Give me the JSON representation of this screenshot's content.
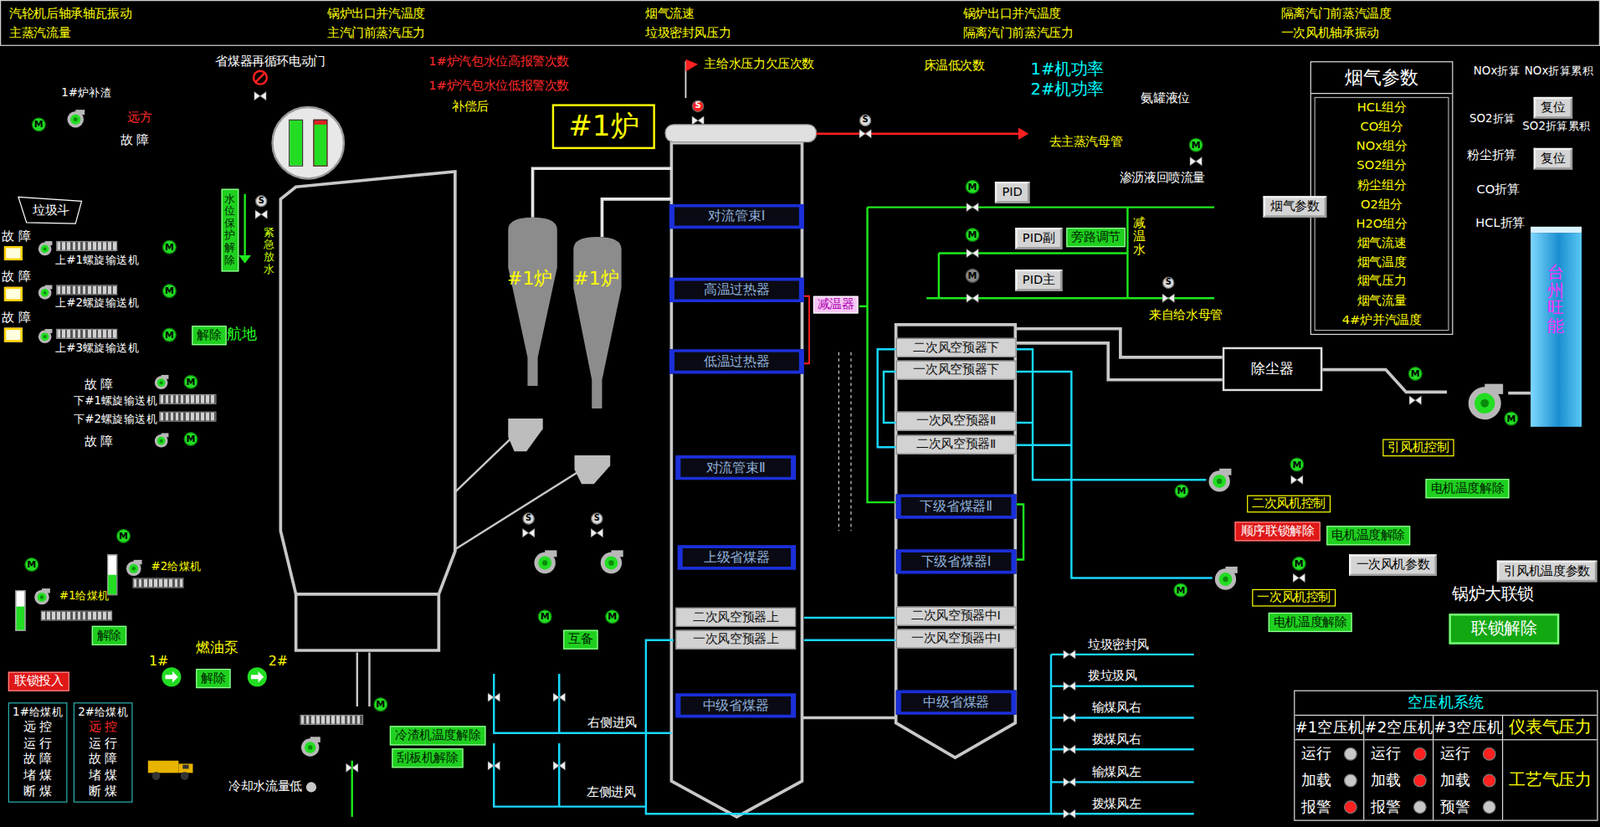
{
  "topBar": [
    "汽轮机后轴承轴瓦振动",
    "锅炉出口并汽温度",
    "烟气流速",
    "锅炉出口并汽温度",
    "隔离汽门前蒸汽温度",
    "主蒸汽流量",
    "主汽门前蒸汽压力",
    "垃圾密封风压力",
    "隔离汽门前蒸汽压力",
    "一次风机轴承振动"
  ],
  "labels": [
    {
      "text": "省煤器再循环电动门",
      "kind": "white"
    },
    {
      "text": "1#炉补渣",
      "kind": "white"
    },
    {
      "text": "远方",
      "kind": "red"
    },
    {
      "text": "故 障",
      "kind": "white"
    },
    {
      "text": "垃圾斗",
      "kind": "white"
    },
    {
      "text": "故 障",
      "kind": "white"
    },
    {
      "text": "上#1螺旋输送机",
      "kind": "white"
    },
    {
      "text": "故 障",
      "kind": "white"
    },
    {
      "text": "上#2螺旋输送机",
      "kind": "white"
    },
    {
      "text": "故 障",
      "kind": "white"
    },
    {
      "text": "上#3螺旋输送机",
      "kind": "white"
    },
    {
      "text": "解除",
      "kind": "btn"
    },
    {
      "text": "航地",
      "kind": "green"
    },
    {
      "text": "故 障",
      "kind": "white"
    },
    {
      "text": "下#1螺旋输送机",
      "kind": "white"
    },
    {
      "text": "下#2螺旋输送机",
      "kind": "white"
    },
    {
      "text": "故 障",
      "kind": "white"
    },
    {
      "text": "#2给煤机",
      "kind": "yellow"
    },
    {
      "text": "#1给煤机",
      "kind": "yellow"
    },
    {
      "text": "解除",
      "kind": "btn"
    },
    {
      "text": "联锁投入",
      "kind": "btnRed"
    },
    {
      "text": "燃油泵",
      "kind": "yellow"
    },
    {
      "text": "1#",
      "kind": "yellow"
    },
    {
      "text": "2#",
      "kind": "yellow"
    },
    {
      "text": "解除",
      "kind": "btn"
    },
    {
      "text": "冷渣机温度解除",
      "kind": "btn"
    },
    {
      "text": "刮板机解除",
      "kind": "btn"
    },
    {
      "text": "冷却水流量低",
      "kind": "white"
    },
    {
      "text": "1#炉汽包水位高报警次数",
      "kind": "red"
    },
    {
      "text": "1#炉汽包水位低报警次数",
      "kind": "red"
    },
    {
      "text": "补偿后",
      "kind": "yellow"
    },
    {
      "text": "主给水压力欠压次数",
      "kind": "yellow"
    },
    {
      "text": "床温低次数",
      "kind": "yellow"
    },
    {
      "text": "1#机功率",
      "kind": "cyan"
    },
    {
      "text": "2#机功率",
      "kind": "cyan"
    },
    {
      "text": "氨罐液位",
      "kind": "white"
    },
    {
      "text": "去主蒸汽母管",
      "kind": "yellow"
    },
    {
      "text": "渗沥液回喷流量",
      "kind": "white"
    },
    {
      "text": "PID",
      "kind": "btnGray"
    },
    {
      "text": "PID副",
      "kind": "btnGray"
    },
    {
      "text": "旁路调节",
      "kind": "btn"
    },
    {
      "text": "PID主",
      "kind": "btnGray"
    },
    {
      "text": "减温器",
      "kind": "pink"
    },
    {
      "text": "来自给水母管",
      "kind": "yellow"
    },
    {
      "text": "互备",
      "kind": "btn"
    },
    {
      "text": "右侧进风",
      "kind": "white"
    },
    {
      "text": "左侧进风",
      "kind": "white"
    },
    {
      "text": "垃圾密封风",
      "kind": "white"
    },
    {
      "text": "拨垃圾风",
      "kind": "white"
    },
    {
      "text": "输煤风右",
      "kind": "white"
    },
    {
      "text": "拨煤风右",
      "kind": "white"
    },
    {
      "text": "输煤风左",
      "kind": "white"
    },
    {
      "text": "拨煤风左",
      "kind": "white"
    },
    {
      "text": "烟气参数",
      "kind": "btnGray"
    },
    {
      "text": "NOx折算",
      "kind": "white"
    },
    {
      "text": "NOx折算累积",
      "kind": "white"
    },
    {
      "text": "复位",
      "kind": "btnGray"
    },
    {
      "text": "SO2折算",
      "kind": "white"
    },
    {
      "text": "SO2折算累积",
      "kind": "white"
    },
    {
      "text": "粉尘折算",
      "kind": "white"
    },
    {
      "text": "复位",
      "kind": "btnGray"
    },
    {
      "text": "CO折算",
      "kind": "white"
    },
    {
      "text": "HCL折算",
      "kind": "white"
    },
    {
      "text": "引风机控制",
      "kind": "frame"
    },
    {
      "text": "电机温度解除",
      "kind": "btn"
    },
    {
      "text": "二次风机控制",
      "kind": "frame"
    },
    {
      "text": "顺序联锁解除",
      "kind": "btnRed"
    },
    {
      "text": "电机温度解除",
      "kind": "btn"
    },
    {
      "text": "一次风机参数",
      "kind": "btnGray"
    },
    {
      "text": "引风机温度参数",
      "kind": "btnGray"
    },
    {
      "text": "一次风机控制",
      "kind": "frame"
    },
    {
      "text": "电机温度解除",
      "kind": "btn"
    },
    {
      "text": "锅炉大联锁",
      "kind": "white"
    },
    {
      "text": "联锁解除",
      "kind": "btnBig"
    },
    {
      "text": "#1炉",
      "kind": "title"
    },
    {
      "text": "#1炉",
      "kind": "yellow"
    },
    {
      "text": "#1炉",
      "kind": "yellow"
    }
  ],
  "verticals": [
    {
      "text": "水位保护解除",
      "kind": "vbtn"
    },
    {
      "text": "紧急放水",
      "kind": "vlime"
    },
    {
      "text": "减温水",
      "kind": "vyellow"
    },
    {
      "text": "台州旺能",
      "kind": "vchimney"
    }
  ],
  "exchangers": [
    {
      "text": "对流管束Ⅰ",
      "kind": "coil"
    },
    {
      "text": "高温过热器",
      "kind": "coil"
    },
    {
      "text": "低温过热器",
      "kind": "coil"
    },
    {
      "text": "对流管束Ⅱ",
      "kind": "coil"
    },
    {
      "text": "上级省煤器",
      "kind": "coil"
    },
    {
      "text": "二次风空预器上",
      "kind": "air"
    },
    {
      "text": "一次风空预器上",
      "kind": "air"
    },
    {
      "text": "中级省煤器",
      "kind": "coil"
    },
    {
      "text": "二次风空预器下",
      "kind": "air"
    },
    {
      "text": "一次风空预器下",
      "kind": "air"
    },
    {
      "text": "一次风空预器Ⅱ",
      "kind": "air"
    },
    {
      "text": "二次风空预器Ⅱ",
      "kind": "air"
    },
    {
      "text": "下级省煤器Ⅱ",
      "kind": "coil"
    },
    {
      "text": "下级省煤器Ⅰ",
      "kind": "coil"
    },
    {
      "text": "二次风空预器中Ⅰ",
      "kind": "air"
    },
    {
      "text": "一次风空预器中Ⅰ",
      "kind": "air"
    },
    {
      "text": "中级省煤器",
      "kind": "coil"
    }
  ],
  "dustCollector": "除尘器",
  "motorGlyph": "M",
  "solenoidGlyph": "S",
  "motors": [
    {
      "on": true
    },
    {
      "on": true
    },
    {
      "on": true
    },
    {
      "on": true
    },
    {
      "on": true
    },
    {
      "on": true
    },
    {
      "on": true
    },
    {
      "on": true
    },
    {
      "on": true
    },
    {
      "on": true
    },
    {
      "on": true
    },
    {
      "on": true
    },
    {
      "on": true
    },
    {
      "on": false
    },
    {
      "on": true
    },
    {
      "on": true
    },
    {
      "on": true
    },
    {
      "on": true
    },
    {
      "on": true
    },
    {
      "on": true
    },
    {
      "on": true
    }
  ],
  "solenoids": [
    {
      "on": false
    },
    {
      "on": true
    },
    {
      "on": false
    },
    {
      "on": false
    },
    {
      "on": false
    },
    {
      "on": false
    }
  ],
  "recircValveAlarm": true,
  "coolingWaterLow": false,
  "drumGauge": {
    "left": 1,
    "right": 0.9
  },
  "feederLevels": [
    {
      "level": 0.6
    },
    {
      "level": 0.5
    }
  ],
  "faultBoxes": [
    {
      "on": false
    },
    {
      "on": false
    },
    {
      "on": false
    }
  ],
  "feederStatus": [
    {
      "title": "1#给煤机",
      "lines": [
        {
          "text": "远 控",
          "on": false
        },
        {
          "text": "运 行",
          "on": false
        },
        {
          "text": "故 障",
          "on": false
        },
        {
          "text": "堵 煤",
          "on": false
        },
        {
          "text": "断 煤",
          "on": false
        }
      ]
    },
    {
      "title": "2#给煤机",
      "lines": [
        {
          "text": "远 控",
          "on": true
        },
        {
          "text": "运 行",
          "on": false
        },
        {
          "text": "故 障",
          "on": false
        },
        {
          "text": "堵 煤",
          "on": false
        },
        {
          "text": "断 煤",
          "on": false
        }
      ]
    }
  ],
  "fluePanel": {
    "title": "烟气参数",
    "items": [
      "HCL组分",
      "CO组分",
      "NOx组分",
      "SO2组分",
      "粉尘组分",
      "O2组分",
      "H2O组分",
      "烟气流速",
      "烟气温度",
      "烟气压力",
      "烟气流量",
      "4#炉并汽温度"
    ]
  },
  "compressors": {
    "title": "空压机系统",
    "units": [
      {
        "name": "#1空压机",
        "signals": [
          {
            "label": "运行",
            "color": "#c8c8c8"
          },
          {
            "label": "加载",
            "color": "#c8c8c8"
          },
          {
            "label": "报警",
            "color": "#ff2020"
          }
        ]
      },
      {
        "name": "#2空压机",
        "signals": [
          {
            "label": "运行",
            "color": "#ff2020"
          },
          {
            "label": "加载",
            "color": "#ff2020"
          },
          {
            "label": "报警",
            "color": "#c8c8c8"
          }
        ]
      },
      {
        "name": "#3空压机",
        "signals": [
          {
            "label": "运行",
            "color": "#ff2020"
          },
          {
            "label": "加载",
            "color": "#ff2020"
          },
          {
            "label": "预警",
            "color": "#c8c8c8"
          }
        ]
      }
    ],
    "pressures": [
      "仪表气压力",
      "工艺气压力"
    ]
  }
}
